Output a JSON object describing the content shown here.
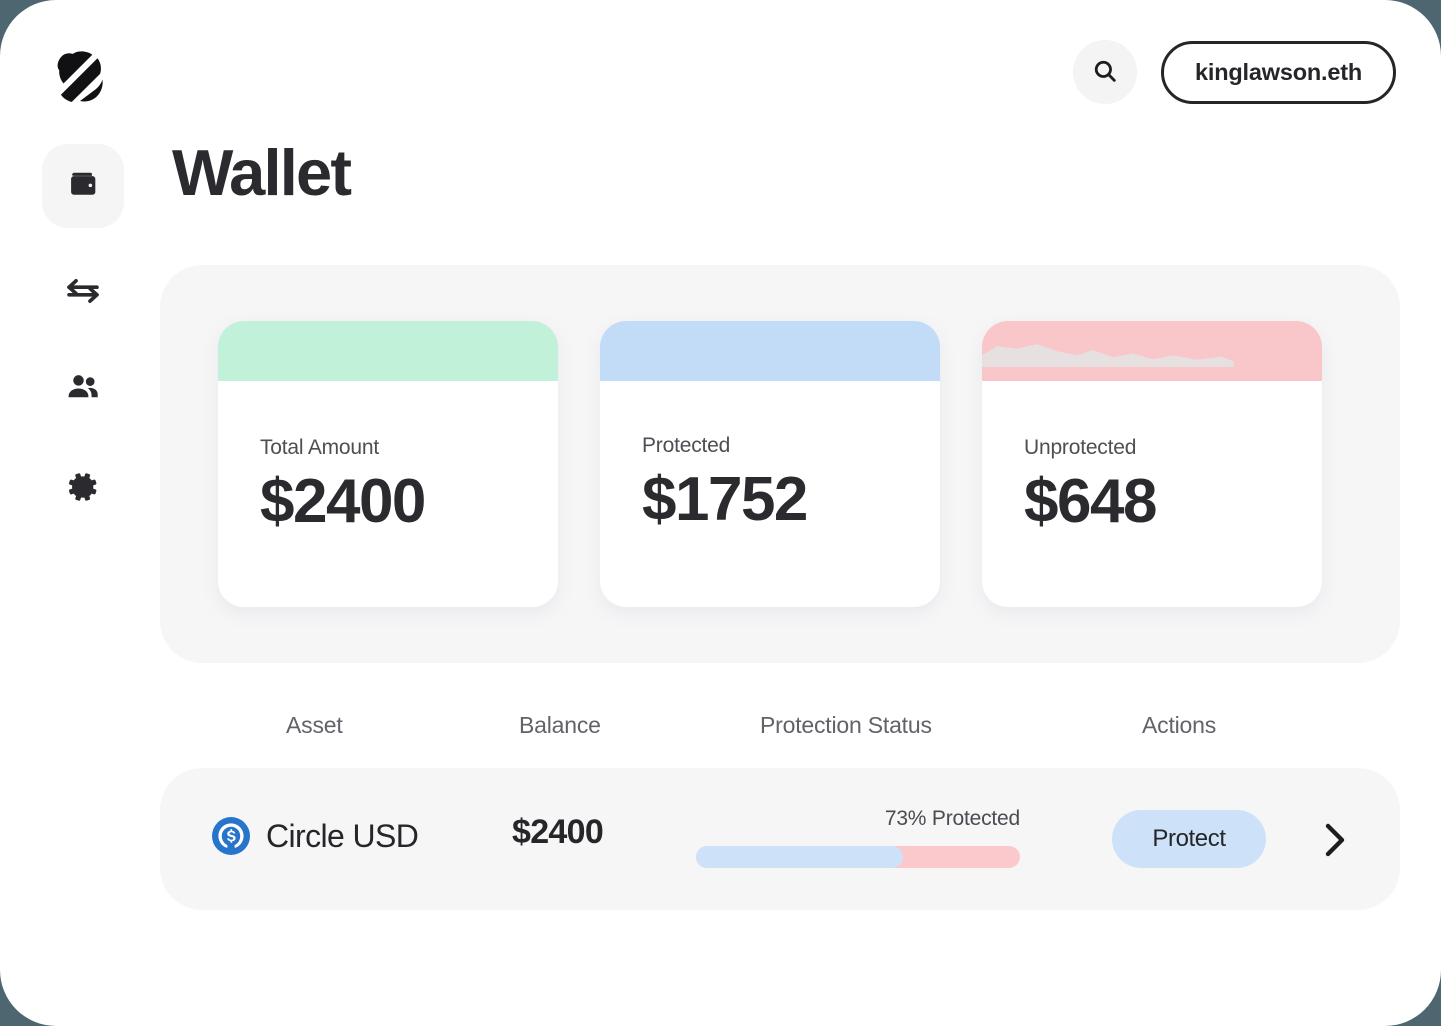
{
  "app": {
    "logo_icon": "sliced-sphere-logo",
    "background_color": "#4d6670",
    "surface_color": "#ffffff"
  },
  "topbar": {
    "search_icon": "search-icon",
    "account": {
      "label": "kinglawson.eth"
    }
  },
  "sidebar": {
    "items": [
      {
        "icon": "wallet-icon",
        "name": "wallet",
        "active": true
      },
      {
        "icon": "swap-arrows-icon",
        "name": "transfer",
        "active": false
      },
      {
        "icon": "people-icon",
        "name": "contacts",
        "active": false
      },
      {
        "icon": "gear-icon",
        "name": "settings",
        "active": false
      }
    ]
  },
  "page": {
    "title": "Wallet"
  },
  "summary": {
    "cards": [
      {
        "label": "Total Amount",
        "value": "$2400",
        "accent": "#c2f1da",
        "variant": "green"
      },
      {
        "label": "Protected",
        "value": "$1752",
        "accent": "#c2dcf8",
        "variant": "blue"
      },
      {
        "label": "Unprotected",
        "value": "$648",
        "accent": "#f9c6ca",
        "variant": "pink"
      }
    ]
  },
  "assets_table": {
    "columns": {
      "asset": "Asset",
      "balance": "Balance",
      "status": "Protection Status",
      "actions": "Actions"
    },
    "rows": [
      {
        "asset_icon": "usdc-coin-icon",
        "asset_name": "Circle USD",
        "balance": "$2400",
        "protection_label": "73% Protected",
        "protection_percent": 73,
        "protection_fill_width": "64%",
        "protected_color": "#cde2f8",
        "unprotected_color": "#fbc9cc",
        "action_label": "Protect",
        "chevron_icon": "chevron-right-icon"
      }
    ]
  }
}
